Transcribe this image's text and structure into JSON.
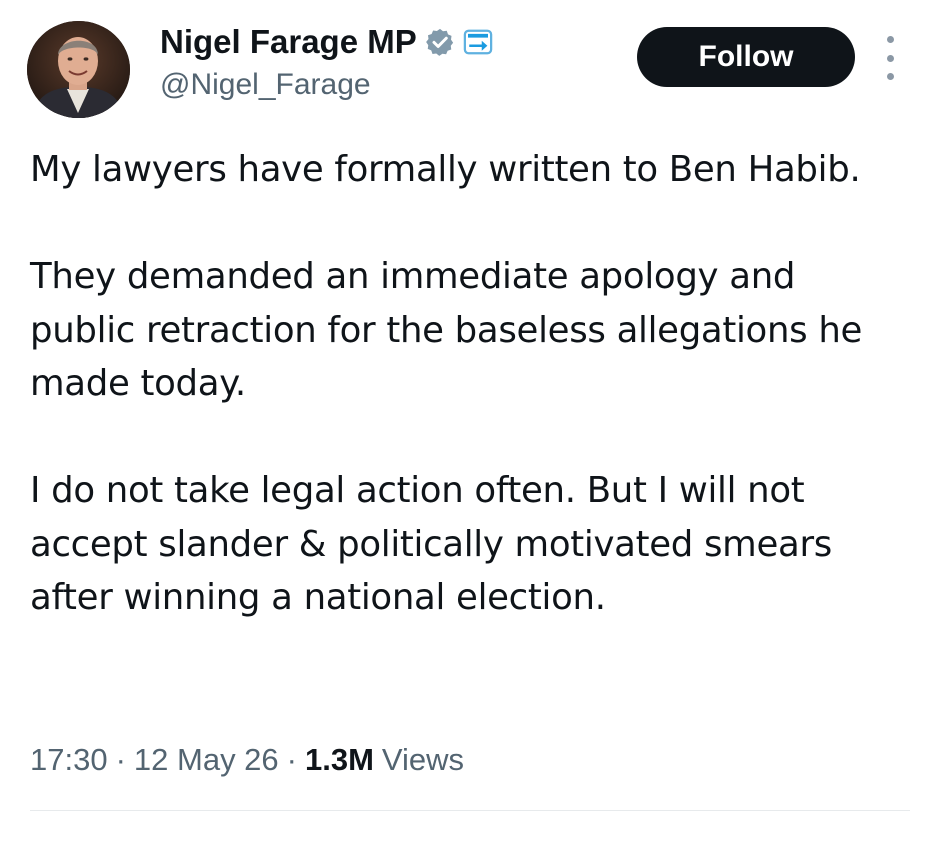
{
  "author": {
    "display_name": "Nigel Farage MP",
    "handle": "@Nigel_Farage",
    "verified_icon": "verified-badge-icon",
    "affiliation_icon": "affiliation-badge-icon"
  },
  "actions": {
    "follow_label": "Follow",
    "more_icon": "more-vertical-icon"
  },
  "tweet": {
    "paragraphs": [
      "My lawyers have formally written to Ben Habib.",
      "They demanded an immediate apology and public retraction for the baseless allegations he made today.",
      "I do not take legal action often. But I will not accept slander & politically motivated smears after winning a national election."
    ]
  },
  "meta": {
    "time": "17:30",
    "date": "12 May 26",
    "views_count": "1.3M",
    "views_label": "Views"
  },
  "colors": {
    "text_primary": "#0f1419",
    "text_secondary": "#536471",
    "follow_bg": "#0f1419",
    "verified_badge": "#829aab"
  }
}
